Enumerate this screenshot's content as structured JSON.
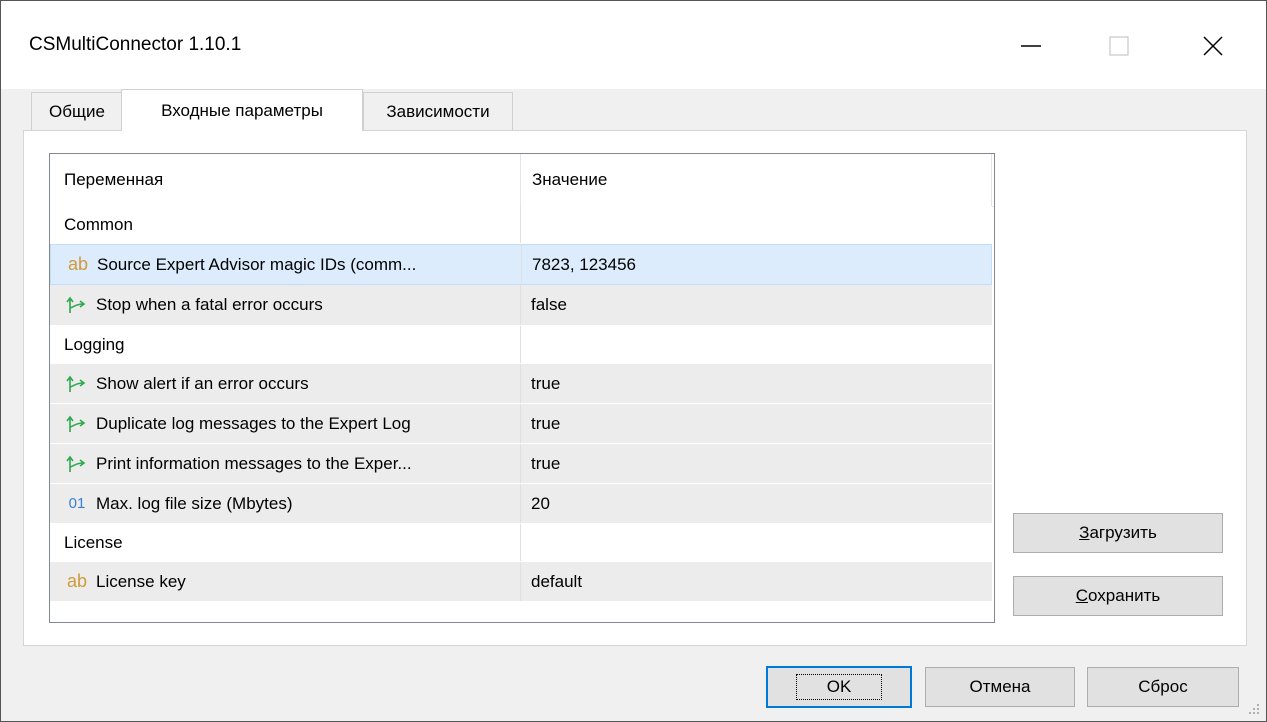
{
  "window": {
    "title": "CSMultiConnector 1.10.1"
  },
  "tabs": [
    {
      "label": "Общие",
      "active": false
    },
    {
      "label": "Входные параметры",
      "active": true
    },
    {
      "label": "Зависимости",
      "active": false
    }
  ],
  "grid": {
    "columns": {
      "name": "Переменная",
      "value": "Значение"
    },
    "rows": [
      {
        "type": "group",
        "name": "Common",
        "value": ""
      },
      {
        "type": "param",
        "icon": "ab-string-icon",
        "glyph": "ab",
        "name": "Source Expert Advisor magic IDs (comm...",
        "value": "7823, 123456",
        "selected": true
      },
      {
        "type": "param",
        "icon": "bool-arrow-icon",
        "name": "Stop when a fatal error occurs",
        "value": "false"
      },
      {
        "type": "group",
        "name": "Logging",
        "value": ""
      },
      {
        "type": "param",
        "icon": "bool-arrow-icon",
        "name": "Show alert if an error occurs",
        "value": "true"
      },
      {
        "type": "param",
        "icon": "bool-arrow-icon",
        "name": "Duplicate log messages to the Expert Log",
        "value": "true"
      },
      {
        "type": "param",
        "icon": "bool-arrow-icon",
        "name": "Print information messages to the Exper...",
        "value": "true"
      },
      {
        "type": "param",
        "icon": "integer-icon",
        "glyph": "01",
        "name": "Max. log file size (Mbytes)",
        "value": "20"
      },
      {
        "type": "group",
        "name": "License",
        "value": ""
      },
      {
        "type": "param",
        "icon": "ab-string-icon",
        "glyph": "ab",
        "name": "License key",
        "value": "default"
      }
    ]
  },
  "side_buttons": {
    "load": "Загрузить",
    "save": "Сохранить"
  },
  "footer_buttons": {
    "ok": "OK",
    "cancel": "Отмена",
    "reset": "Сброс"
  },
  "colors": {
    "selected_row": "#dcecfc",
    "alt_row": "#ececec",
    "default_button_border": "#0078d7",
    "string_icon": "#d19a3a",
    "bool_icon": "#2fa84f",
    "integer_icon": "#3a7fd1"
  }
}
